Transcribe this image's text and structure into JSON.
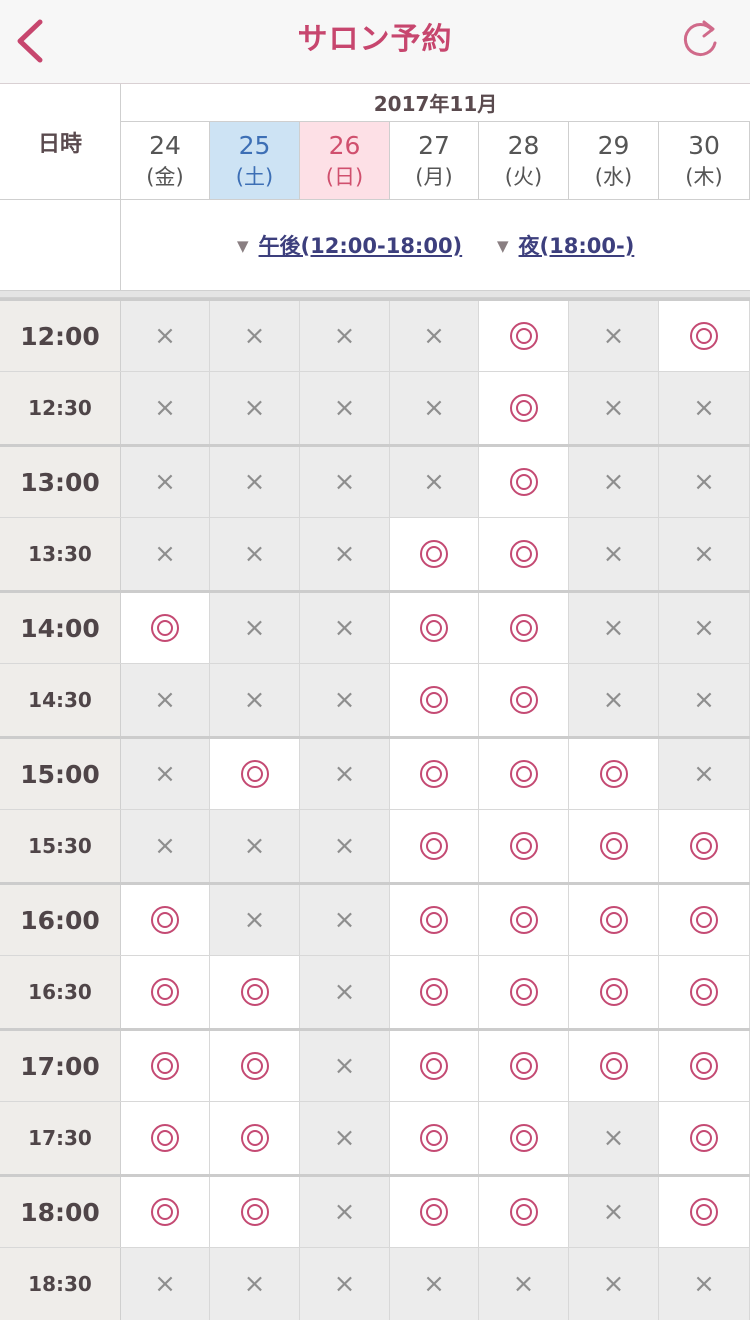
{
  "nav": {
    "title": "サロン予約",
    "back_icon": "chevron-left-icon",
    "reload_icon": "reload-icon"
  },
  "header": {
    "corner_label": "日時",
    "month_label": "2017年11月",
    "days": [
      {
        "num": "24",
        "dow": "(金)",
        "type": "weekday"
      },
      {
        "num": "25",
        "dow": "(土)",
        "type": "sat"
      },
      {
        "num": "26",
        "dow": "(日)",
        "type": "sun"
      },
      {
        "num": "27",
        "dow": "(月)",
        "type": "weekday"
      },
      {
        "num": "28",
        "dow": "(火)",
        "type": "weekday"
      },
      {
        "num": "29",
        "dow": "(水)",
        "type": "weekday"
      },
      {
        "num": "30",
        "dow": "(木)",
        "type": "weekday"
      }
    ],
    "jumps": [
      {
        "label": "午後(12:00-18:00)",
        "marker": "▼"
      },
      {
        "label": "夜(18:00-)",
        "marker": "▼"
      }
    ]
  },
  "symbols": {
    "available": "◎",
    "unavailable": "×"
  },
  "schedule": [
    {
      "time": "12:00",
      "slots": [
        "x",
        "x",
        "x",
        "x",
        "o",
        "x",
        "o"
      ]
    },
    {
      "time": "12:30",
      "slots": [
        "x",
        "x",
        "x",
        "x",
        "o",
        "x",
        "x"
      ]
    },
    {
      "time": "13:00",
      "slots": [
        "x",
        "x",
        "x",
        "x",
        "o",
        "x",
        "x"
      ]
    },
    {
      "time": "13:30",
      "slots": [
        "x",
        "x",
        "x",
        "o",
        "o",
        "x",
        "x"
      ]
    },
    {
      "time": "14:00",
      "slots": [
        "o",
        "x",
        "x",
        "o",
        "o",
        "x",
        "x"
      ]
    },
    {
      "time": "14:30",
      "slots": [
        "x",
        "x",
        "x",
        "o",
        "o",
        "x",
        "x"
      ]
    },
    {
      "time": "15:00",
      "slots": [
        "x",
        "o",
        "x",
        "o",
        "o",
        "o",
        "x"
      ]
    },
    {
      "time": "15:30",
      "slots": [
        "x",
        "x",
        "x",
        "o",
        "o",
        "o",
        "o"
      ]
    },
    {
      "time": "16:00",
      "slots": [
        "o",
        "x",
        "x",
        "o",
        "o",
        "o",
        "o"
      ]
    },
    {
      "time": "16:30",
      "slots": [
        "o",
        "o",
        "x",
        "o",
        "o",
        "o",
        "o"
      ]
    },
    {
      "time": "17:00",
      "slots": [
        "o",
        "o",
        "x",
        "o",
        "o",
        "o",
        "o"
      ]
    },
    {
      "time": "17:30",
      "slots": [
        "o",
        "o",
        "x",
        "o",
        "o",
        "x",
        "o"
      ]
    },
    {
      "time": "18:00",
      "slots": [
        "o",
        "o",
        "x",
        "o",
        "o",
        "x",
        "o"
      ]
    },
    {
      "time": "18:30",
      "slots": [
        "x",
        "x",
        "x",
        "x",
        "x",
        "x",
        "x"
      ]
    }
  ],
  "colors": {
    "accent": "#c7466e",
    "saturday": "#cde3f4",
    "sunday": "#fde0e6",
    "link": "#3d3f7d"
  }
}
